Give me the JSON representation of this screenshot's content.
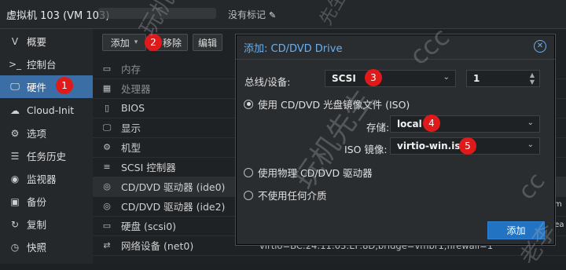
{
  "header": {
    "vm_title": "虚拟机 103 (VM 103)",
    "no_tags": "没有标记"
  },
  "sidebar": {
    "items": [
      {
        "icon": "ᐯ",
        "icon_name": "summary-icon",
        "label": "概要"
      },
      {
        "icon": ">_",
        "icon_name": "console-icon",
        "label": "控制台"
      },
      {
        "icon": "🖵",
        "icon_name": "monitor-icon",
        "label": "硬件"
      },
      {
        "icon": "☁",
        "icon_name": "cloud-icon",
        "label": "Cloud-Init"
      },
      {
        "icon": "⚙",
        "icon_name": "gear-icon",
        "label": "选项"
      },
      {
        "icon": "☰",
        "icon_name": "list-icon",
        "label": "任务历史"
      },
      {
        "icon": "◉",
        "icon_name": "eye-icon",
        "label": "监视器"
      },
      {
        "icon": "▣",
        "icon_name": "floppy-icon",
        "label": "备份"
      },
      {
        "icon": "↻",
        "icon_name": "retweet-icon",
        "label": "复制"
      },
      {
        "icon": "◷",
        "icon_name": "history-icon",
        "label": "快照"
      }
    ]
  },
  "toolbar": {
    "add": "添加",
    "remove": "移除",
    "edit": "编辑"
  },
  "hardware": {
    "rows": [
      {
        "icon": "▭",
        "icon_name": "memory-icon",
        "label": "内存",
        "value": ""
      },
      {
        "icon": "▦",
        "icon_name": "cpu-icon",
        "label": "处理器",
        "value": ""
      },
      {
        "icon": "▯",
        "icon_name": "chip-icon",
        "label": "BIOS",
        "value": ""
      },
      {
        "icon": "🖵",
        "icon_name": "display-icon",
        "label": "显示",
        "value": ""
      },
      {
        "icon": "⚙",
        "icon_name": "cogs-icon",
        "label": "机型",
        "value": ""
      },
      {
        "icon": "≡",
        "icon_name": "database-icon",
        "label": "SCSI 控制器",
        "value": ""
      },
      {
        "icon": "◎",
        "icon_name": "cdrom-icon",
        "label": "CD/DVD 驱动器 (ide0)",
        "value": ""
      },
      {
        "icon": "◎",
        "icon_name": "cdrom-icon",
        "label": "CD/DVD 驱动器 (ide2)",
        "value": ""
      },
      {
        "icon": "▭",
        "icon_name": "hdd-icon",
        "label": "硬盘 (scsi0)",
        "value": ""
      },
      {
        "icon": "⇄",
        "icon_name": "network-icon",
        "label": "网络设备 (net0)",
        "value": "virtio=BC:24:11:03:EF:8D,bridge=vmbr1,firewall=1"
      }
    ]
  },
  "right_fragments": {
    "line1": "rom",
    "line2": "hrea"
  },
  "dialog": {
    "title": "添加: CD/DVD Drive",
    "bus_label": "总线/设备:",
    "bus_value": "SCSI",
    "device_value": "1",
    "opt_iso": "使用 CD/DVD 光盘镜像文件 (ISO)",
    "storage_label": "存储:",
    "storage_value": "local",
    "iso_label": "ISO 镜像:",
    "iso_value": "virtio-win.iso",
    "opt_physical": "使用物理 CD/DVD 驱动器",
    "opt_none": "不使用任何介质",
    "add_button": "添加"
  },
  "badges": [
    "1",
    "2",
    "3",
    "4",
    "5"
  ],
  "watermarks": [
    "玩机",
    "先生",
    "ccc",
    "玩机先生",
    "老李",
    "cc"
  ],
  "colors": {
    "accent": "#3b6ea5",
    "dialog_title": "#6ab0f0",
    "badge": "#e01a1a",
    "add_button": "#2273c2"
  }
}
